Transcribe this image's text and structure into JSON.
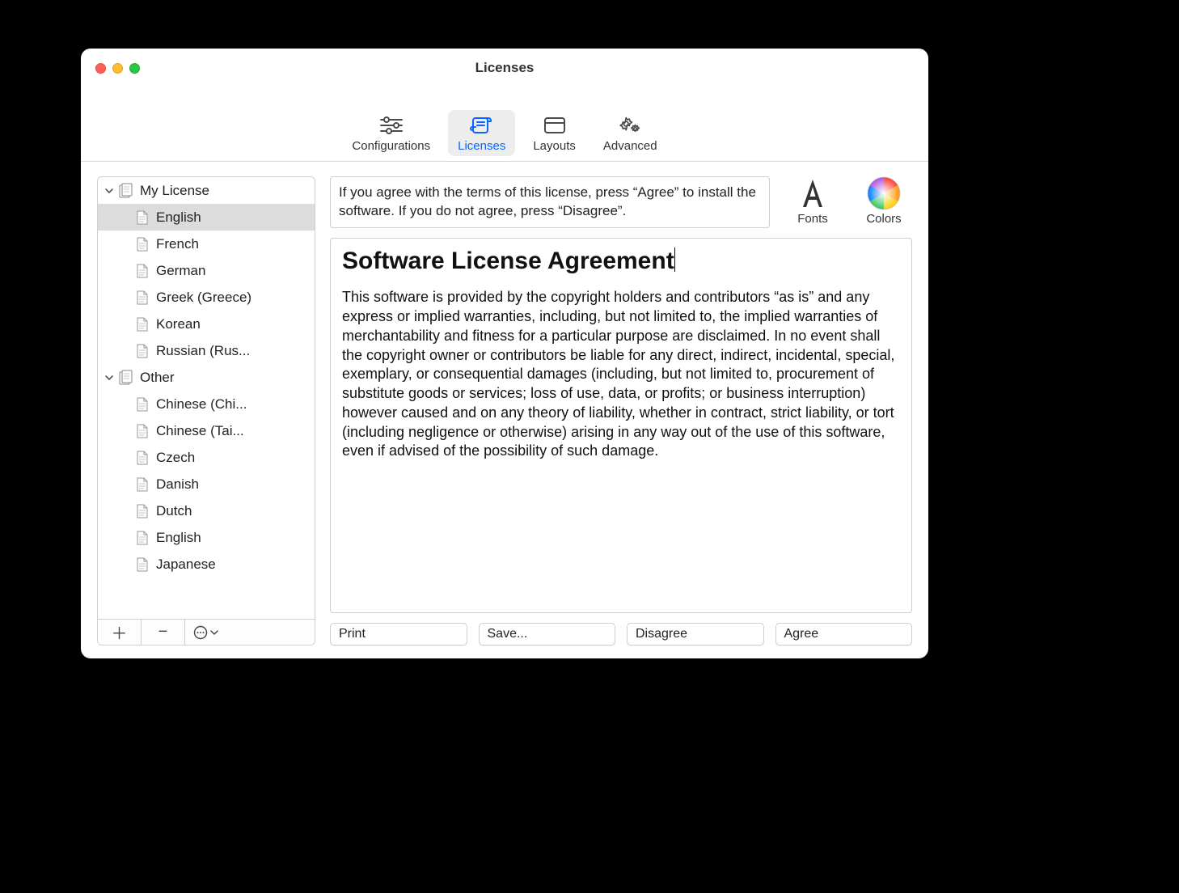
{
  "window": {
    "title": "Licenses"
  },
  "toolbar": {
    "items": [
      {
        "label": "Configurations"
      },
      {
        "label": "Licenses"
      },
      {
        "label": "Layouts"
      },
      {
        "label": "Advanced"
      }
    ],
    "selected_index": 1
  },
  "sidebar": {
    "groups": [
      {
        "label": "My License",
        "items": [
          {
            "label": "English",
            "selected": true
          },
          {
            "label": "French"
          },
          {
            "label": "German"
          },
          {
            "label": "Greek (Greece)"
          },
          {
            "label": "Korean"
          },
          {
            "label": "Russian (Rus..."
          }
        ]
      },
      {
        "label": "Other",
        "items": [
          {
            "label": "Chinese (Chi..."
          },
          {
            "label": "Chinese (Tai..."
          },
          {
            "label": "Czech"
          },
          {
            "label": "Danish"
          },
          {
            "label": "Dutch"
          },
          {
            "label": "English"
          },
          {
            "label": "Japanese"
          }
        ]
      }
    ]
  },
  "main": {
    "instructions": "If you agree with the terms of this license, press “Agree” to install the software. If you do not agree, press “Disagree”.",
    "fonts_label": "Fonts",
    "colors_label": "Colors",
    "heading": "Software License Agreement",
    "body_text": "This software is provided by the copyright holders and contributors “as is” and any express or implied warranties, including, but not limited to, the implied warranties of merchantability and fitness for a particular purpose are disclaimed. In no event shall the copyright owner or contributors be liable for any direct, indirect, incidental, special, exemplary, or consequential damages (including, but not limited to, procurement of substitute goods or services; loss of use, data, or profits; or business interruption) however caused and on any theory of liability, whether in contract, strict liability, or tort (including negligence or otherwise) arising in any way out of the use of this software, even if advised of the possibility of such damage.",
    "buttons": {
      "print": "Print",
      "save": "Save...",
      "disagree": "Disagree",
      "agree": "Agree"
    }
  }
}
